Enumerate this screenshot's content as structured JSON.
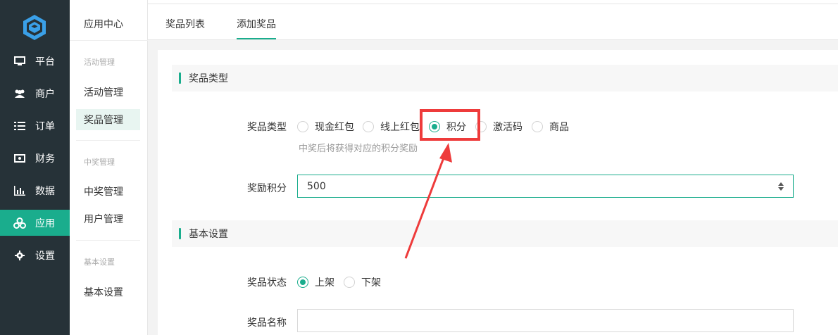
{
  "nav": {
    "items": [
      {
        "label": "平台",
        "icon": "monitor-icon"
      },
      {
        "label": "商户",
        "icon": "users-icon"
      },
      {
        "label": "订单",
        "icon": "list-icon"
      },
      {
        "label": "财务",
        "icon": "money-icon"
      },
      {
        "label": "数据",
        "icon": "bar-chart-icon"
      },
      {
        "label": "应用",
        "icon": "cubes-icon"
      },
      {
        "label": "设置",
        "icon": "gear-icon"
      }
    ],
    "active_index": 5,
    "active_color": "#1aad8d"
  },
  "sidebar": {
    "header": "应用中心",
    "groups": [
      {
        "title": "活动管理",
        "items": [
          "活动管理",
          "奖品管理"
        ]
      },
      {
        "title": "中奖管理",
        "items": [
          "中奖管理",
          "用户管理"
        ]
      },
      {
        "title": "基本设置",
        "items": [
          "基本设置"
        ]
      }
    ],
    "active_item": "奖品管理"
  },
  "tabs": [
    {
      "label": "奖品列表"
    },
    {
      "label": "添加奖品"
    }
  ],
  "active_tab": "添加奖品",
  "form": {
    "section1_title": "奖品类型",
    "prize_type_label": "奖品类型",
    "prize_type_options": [
      "现金红包",
      "线上红包",
      "积分",
      "激活码",
      "商品"
    ],
    "prize_type_selected": "积分",
    "prize_type_hint": "中奖后将获得对应的积分奖励",
    "points_label": "奖励积分",
    "points_value": "500",
    "section2_title": "基本设置",
    "status_label": "奖品状态",
    "status_options": [
      "上架",
      "下架"
    ],
    "status_selected": "上架",
    "name_label": "奖品名称",
    "name_value": ""
  },
  "annotation": {
    "color": "#ee3b3b"
  }
}
